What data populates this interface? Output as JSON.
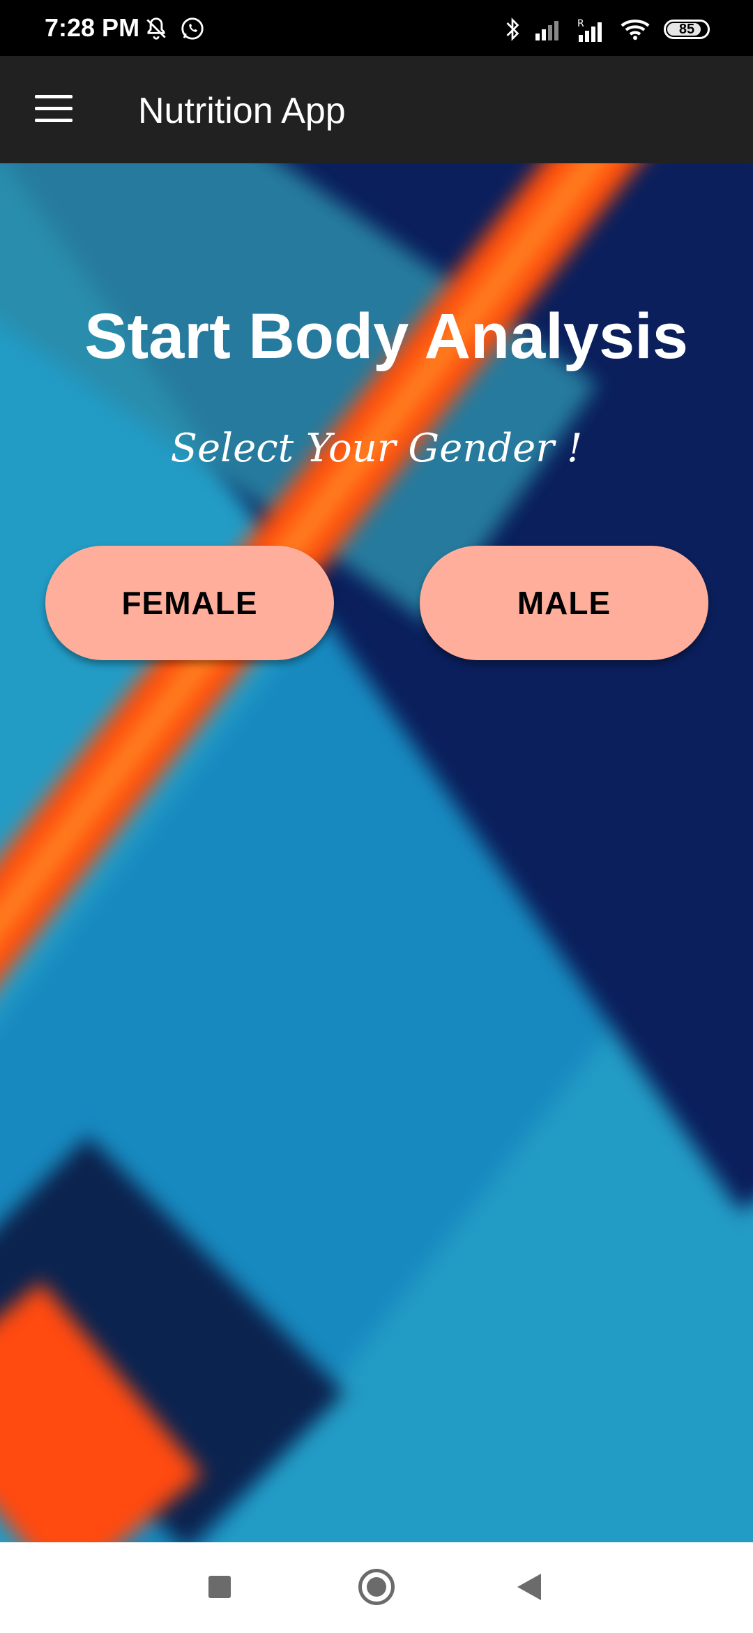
{
  "status_bar": {
    "time": "7:28 PM",
    "battery": "85",
    "battery_level": 0.85,
    "icons_left": [
      "mute-notifications-icon",
      "whatsapp-icon"
    ],
    "icons_right": [
      "bluetooth-icon",
      "signal-icon",
      "roaming-signal-icon",
      "wifi-icon",
      "battery-icon"
    ]
  },
  "app_bar": {
    "title": "Nutrition App",
    "menu_icon": "hamburger-menu-icon"
  },
  "main": {
    "headline": "Start Body Analysis",
    "subheadline": "Select Your Gender !",
    "buttons": {
      "female": "FEMALE",
      "male": "MALE"
    },
    "colors": {
      "button_bg": "#ffae9b",
      "background_blue": "#229bc5",
      "background_navy": "#0a1f5c",
      "accent_orange": "#ff4c0a"
    }
  },
  "nav_bar": {
    "icons": [
      "recent-apps-icon",
      "home-icon",
      "back-icon"
    ]
  }
}
